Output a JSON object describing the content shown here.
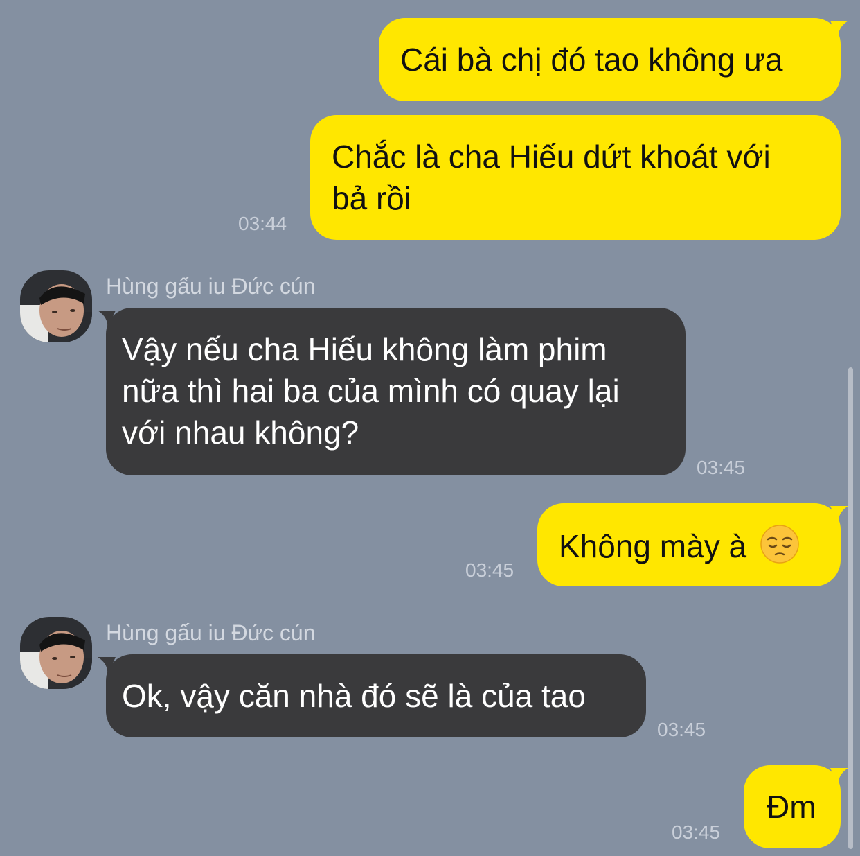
{
  "conversation": {
    "contact_name": "Hùng gấu iu Đức cún",
    "colors": {
      "background": "#8490a1",
      "outgoing_bubble": "#ffe700",
      "incoming_bubble": "#3a3a3c"
    },
    "messages": [
      {
        "sender": "me",
        "text": "Cái bà chị đó tao không ưa"
      },
      {
        "sender": "me",
        "line1": "Chắc là cha Hiếu dứt khoát với",
        "line2": "bả rồi",
        "time": "03:44"
      },
      {
        "sender": "contact",
        "name": "Hùng gấu iu Đức cún",
        "line1": "Vậy nếu cha Hiếu không làm phim",
        "line2": "nữa thì hai ba của mình có quay lại",
        "line3": "với nhau không?",
        "time": "03:45"
      },
      {
        "sender": "me",
        "text": "Không mày à",
        "emoji": "pensive-face-emoji",
        "time": "03:45"
      },
      {
        "sender": "contact",
        "name": "Hùng gấu iu Đức cún",
        "text": "Ok, vậy căn nhà đó sẽ là của tao",
        "time": "03:45"
      },
      {
        "sender": "me",
        "text": "Đm",
        "time": "03:45"
      }
    ]
  }
}
